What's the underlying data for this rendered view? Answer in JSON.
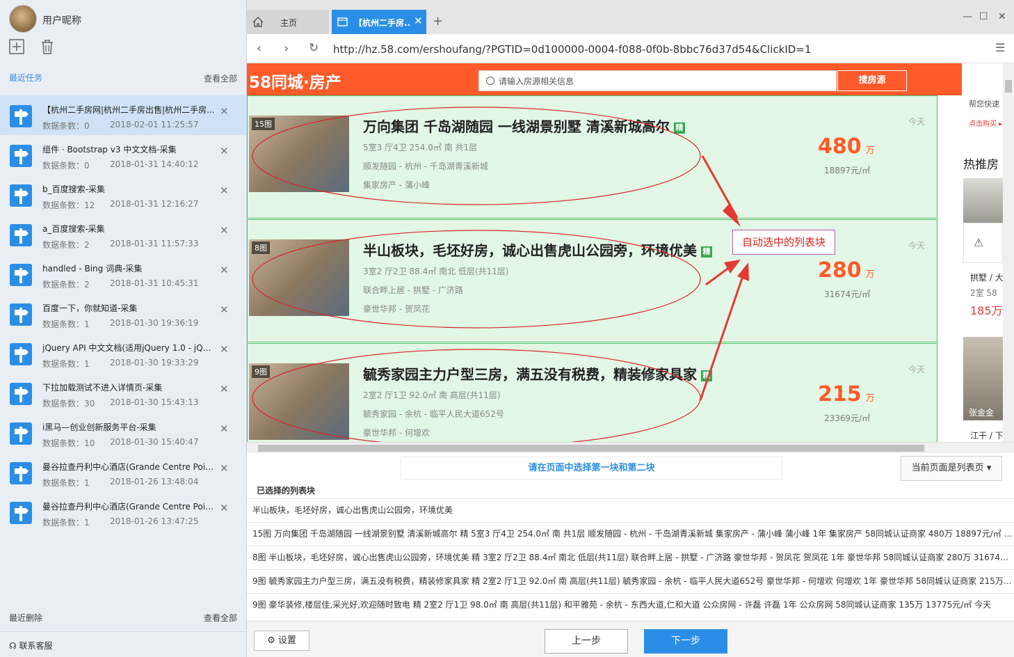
{
  "sidebar": {
    "nickname": "用户昵称",
    "recent_tasks_label": "最近任务",
    "view_all_label": "查看全部",
    "tasks": [
      {
        "title": "【杭州二手房网|杭州二手房出售|杭州二手房...",
        "count": "数据条数：0",
        "date": "2018-02-01 11:25:57"
      },
      {
        "title": "组件 · Bootstrap v3 中文文档-采集",
        "count": "数据条数：0",
        "date": "2018-01-31 14:40:12"
      },
      {
        "title": "b_百度搜索-采集",
        "count": "数据条数：12",
        "date": "2018-01-31 12:16:27"
      },
      {
        "title": "a_百度搜索-采集",
        "count": "数据条数：2",
        "date": "2018-01-31 11:57:33"
      },
      {
        "title": "handled - Bing 词典-采集",
        "count": "数据条数：2",
        "date": "2018-01-31 10:45:31"
      },
      {
        "title": "百度一下，你就知道-采集",
        "count": "数据条数：1",
        "date": "2018-01-30 19:36:19"
      },
      {
        "title": "jQuery API 中文文档(适用jQuery 1.0 - jQuer...",
        "count": "数据条数：1",
        "date": "2018-01-30 19:33:29"
      },
      {
        "title": "下拉加载测试不进入详情页-采集",
        "count": "数据条数：30",
        "date": "2018-01-30 15:43:13"
      },
      {
        "title": "i黑马—创业创新服务平台-采集",
        "count": "数据条数：10",
        "date": "2018-01-30 15:40:47"
      },
      {
        "title": "曼谷拉查丹利中心酒店(Grande Centre Poin...",
        "count": "数据条数：1",
        "date": "2018-01-26 13:48:04"
      },
      {
        "title": "曼谷拉查丹利中心酒店(Grande Centre Poin...",
        "count": "数据条数：1",
        "date": "2018-01-26 13:47:25"
      }
    ],
    "recent_deleted_label": "最近删除",
    "view_all_deleted_label": "查看全部",
    "support_label": "联系客服"
  },
  "browser": {
    "tab_home_label": "主页",
    "tab_active_label": "【杭州二手房..",
    "url": "http://hz.58.com/ershoufang/?PGTID=0d100000-0004-f088-0f0b-8bbc76d37d54&ClickID=1"
  },
  "site": {
    "logo_text": "58同城·房产",
    "search_placeholder": "请输入房源相关信息",
    "search_button": "搜房源",
    "right_col": {
      "help_text": "帮您快速",
      "buy_link": "点击购买 ▸",
      "hot_label": "热推房",
      "card_loc": "拱墅 / 大",
      "card_rooms": "2室  58",
      "card_price": "185万",
      "agent_name": "张金金",
      "card2_loc": "江干 / 下"
    },
    "listings": [
      {
        "photo_count": "15图",
        "title": "万向集团 千岛湖随园 一线湖景别墅 清溪新城高尔",
        "badge": "精",
        "line1": "5室3 厅4卫    254.0㎡      南      共1层",
        "line2": "顺发随园 -  杭州  - 千岛湖青溪新城",
        "line3": "集家房产 -  蒲小峰",
        "today": "今天",
        "price": "480",
        "price_unit": "万",
        "per_sqm": "18897元/㎡"
      },
      {
        "photo_count": "8图",
        "title": "半山板块，毛坯好房，诚心出售虎山公园旁，环境优美",
        "badge": "精",
        "line1": "3室2 厅2卫    88.4㎡      南北    低层(共11层)",
        "line2": "联合畔上居 -  拱墅  - 广济路",
        "line3": "豪世华邦 -  贺凤花",
        "today": "今天",
        "price": "280",
        "price_unit": "万",
        "per_sqm": "31674元/㎡"
      },
      {
        "photo_count": "9图",
        "title": "毓秀家园主力户型三房，满五没有税费，精装修家具家",
        "badge": "精",
        "line1": "2室2 厅1卫    92.0㎡      南      高层(共11层)",
        "line2": "毓秀家园 -  余杭  - 临平人民大道652号",
        "line3": "豪世华邦 -  何增欢",
        "today": "今天",
        "price": "215",
        "price_unit": "万",
        "per_sqm": "23369元/㎡"
      }
    ],
    "callout_text": "自动选中的列表块"
  },
  "panel": {
    "prompt": "请在页面中选择第一块和第二块",
    "page_type": "当前页面是列表页 ▾",
    "chosen_title": "已选择的列表块",
    "chosen_rows": [
      "半山板块，毛坯好房，诚心出售虎山公园旁，环境优美",
      "15图 万向集团 千岛湖随园 一线湖景别墅 清溪新城高尔 精 5室3 厅4卫 254.0㎡ 南 共1层 顺发随园 -  杭州  - 千岛湖青溪新城 集家房产 -  蒲小峰 蒲小峰 1年 集家房产 58同城认证商家 480万 18897元/㎡ 今天",
      "8图 半山板块，毛坯好房，诚心出售虎山公园旁，环境优美 精 3室2 厅2卫 88.4㎡ 南北 低层(共11层) 联合畔上居 -  拱墅  - 广济路 豪世华邦 -  贺凤花 贺凤花 1年 豪世华邦 58同城认证商家 280万 31674元/...",
      "9图 毓秀家园主力户型三房，满五没有税费，精装修家具家 精 2室2 厅1卫 92.0㎡ 南 高层(共11层) 毓秀家园 -  余杭  - 临平人民大道652号 豪世华邦 -  何增欢 何增欢 1年 豪世华邦 58同城认证商家 215万 2...",
      "9图 豪华装修,楼层佳,采光好,欢迎随时致电 精 2室2 厅1卫 98.0㎡ 南 高层(共11层) 和平雅苑 -  余杭  - 东西大道,仁和大道 公众房网 -  许磊 许磊 1年 公众房网 58同城认证商家 135万 13775元/㎡ 今天"
    ],
    "settings_label": "设置",
    "prev_label": "上一步",
    "next_label": "下一步"
  }
}
